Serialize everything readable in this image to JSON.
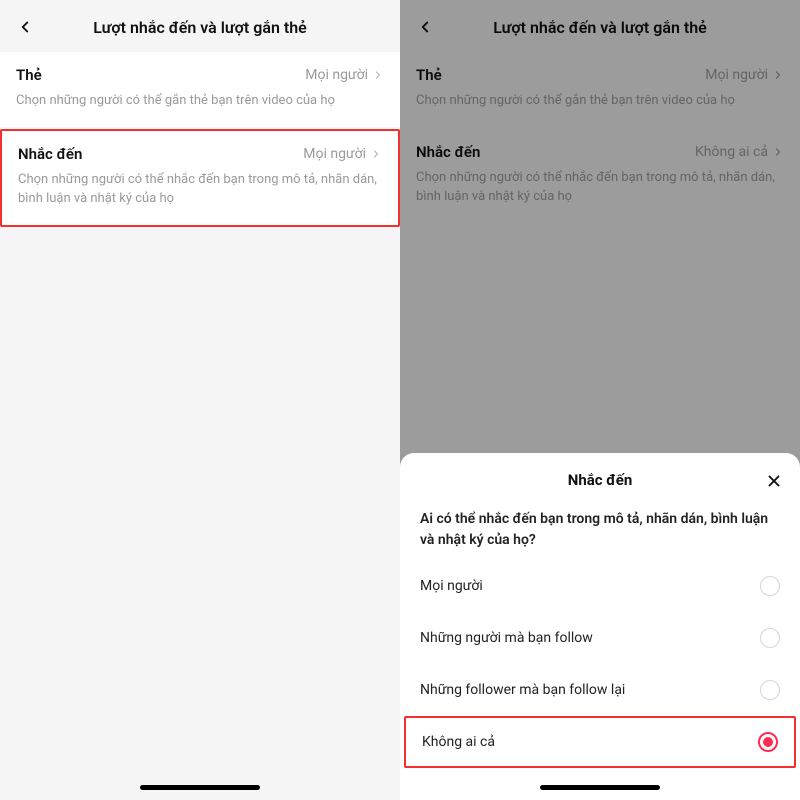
{
  "header": {
    "title": "Lượt nhắc đến và lượt gắn thẻ"
  },
  "left": {
    "tag": {
      "title": "Thẻ",
      "value": "Mọi người",
      "desc": "Chọn những người có thể gắn thẻ bạn trên video của họ"
    },
    "mention": {
      "title": "Nhắc đến",
      "value": "Mọi người",
      "desc": "Chọn những người có thể nhắc đến bạn trong mô tả, nhãn dán, bình luận và nhật ký của họ"
    }
  },
  "right": {
    "tag": {
      "title": "Thẻ",
      "value": "Mọi người",
      "desc": "Chọn những người có thể gắn thẻ bạn trên video của họ"
    },
    "mention": {
      "title": "Nhắc đến",
      "value": "Không ai cả",
      "desc": "Chọn những người có thể nhắc đến bạn trong mô tả, nhãn dán, bình luận và nhật ký của họ"
    }
  },
  "sheet": {
    "title": "Nhắc đến",
    "question": "Ai có thể nhắc đến bạn trong mô tả, nhãn dán, bình luận và nhật ký của họ?",
    "options": [
      {
        "label": "Mọi người",
        "selected": false
      },
      {
        "label": "Những người mà bạn follow",
        "selected": false
      },
      {
        "label": "Những follower mà bạn follow lại",
        "selected": false
      },
      {
        "label": "Không ai cả",
        "selected": true
      }
    ]
  }
}
